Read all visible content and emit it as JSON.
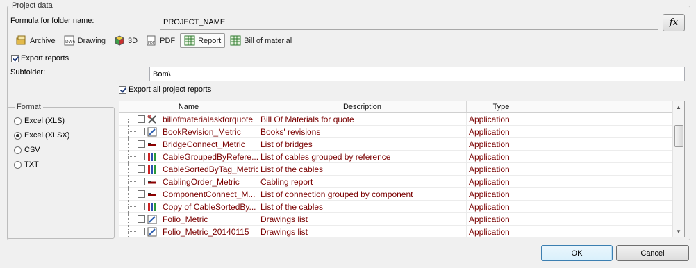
{
  "project_group": {
    "title": "Project data",
    "formula_label": "Formula for folder name:",
    "formula_value": "PROJECT_NAME",
    "fx_label": "fx"
  },
  "tabs": [
    {
      "label": "Archive",
      "icon": "archive-icon"
    },
    {
      "label": "Drawing",
      "icon": "dwg-icon"
    },
    {
      "label": "3D",
      "icon": "3d-icon"
    },
    {
      "label": "PDF",
      "icon": "pdf-icon"
    },
    {
      "label": "Report",
      "icon": "report-table-icon",
      "active": true
    },
    {
      "label": "Bill of material",
      "icon": "bom-table-icon"
    }
  ],
  "export_reports": {
    "label": "Export reports",
    "checked": true
  },
  "subfolder": {
    "label": "Subfolder:",
    "value": "Bom\\"
  },
  "export_all": {
    "label": "Export all project reports",
    "checked": true
  },
  "format_group": {
    "title": "Format",
    "options": [
      {
        "label": "Excel (XLS)",
        "checked": false
      },
      {
        "label": "Excel (XLSX)",
        "checked": true
      },
      {
        "label": "CSV",
        "checked": false
      },
      {
        "label": "TXT",
        "checked": false
      }
    ]
  },
  "table": {
    "columns": [
      "Name",
      "Description",
      "Type"
    ],
    "rows": [
      {
        "name": "billofmaterialaskforquote",
        "description": "Bill Of Materials for quote",
        "type": "Application",
        "icon": "tools-icon"
      },
      {
        "name": "BookRevision_Metric",
        "description": "Books' revisions",
        "type": "Application",
        "icon": "drawing-pencil-icon"
      },
      {
        "name": "BridgeConnect_Metric",
        "description": "List of bridges",
        "type": "Application",
        "icon": "cable-icon"
      },
      {
        "name": "CableGroupedByRefere...",
        "description": "List of cables grouped by reference",
        "type": "Application",
        "icon": "cable-list-icon"
      },
      {
        "name": "CableSortedByTag_Metric",
        "description": "List of the cables",
        "type": "Application",
        "icon": "cable-list-icon"
      },
      {
        "name": "CablingOrder_Metric",
        "description": "Cabling report",
        "type": "Application",
        "icon": "cable-icon"
      },
      {
        "name": "ComponentConnect_M...",
        "description": "List of connection grouped by component",
        "type": "Application",
        "icon": "cable-icon"
      },
      {
        "name": "Copy of CableSortedBy...",
        "description": "List of the cables",
        "type": "Application",
        "icon": "cable-list-icon"
      },
      {
        "name": "Folio_Metric",
        "description": "Drawings list",
        "type": "Application",
        "icon": "drawing-pencil-icon"
      },
      {
        "name": "Folio_Metric_20140115",
        "description": "Drawings list",
        "type": "Application",
        "icon": "drawing-pencil-icon"
      }
    ]
  },
  "buttons": {
    "ok": "OK",
    "cancel": "Cancel"
  },
  "colors": {
    "row_text": "#7a0000",
    "accent": "#3c7fb1"
  }
}
